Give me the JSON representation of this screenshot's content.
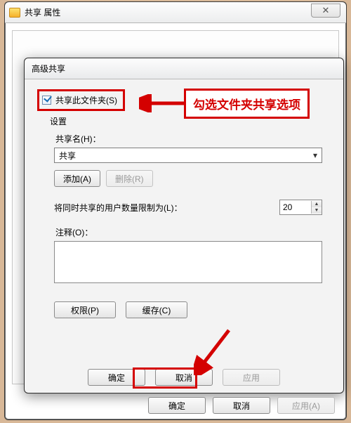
{
  "outer": {
    "title": "共享 属性",
    "close_glyph": "✕",
    "ok_label": "确定",
    "cancel_label": "取消",
    "apply_label": "应用(A)"
  },
  "inner": {
    "title": "高级共享",
    "share_checkbox_label": "共享此文件夹(S)",
    "settings_label": "设置",
    "sharename_label": "共享名(H)：",
    "sharename_value": "共享",
    "add_label": "添加(A)",
    "remove_label": "删除(R)",
    "limit_label": "将同时共享的用户数量限制为(L)：",
    "limit_value": "20",
    "comment_label": "注释(O)：",
    "permissions_label": "权限(P)",
    "cache_label": "缓存(C)",
    "ok_label": "确定",
    "cancel_label": "取消",
    "apply_label": "应用"
  },
  "annotations": {
    "callout_text": "勾选文件夹共享选项"
  }
}
